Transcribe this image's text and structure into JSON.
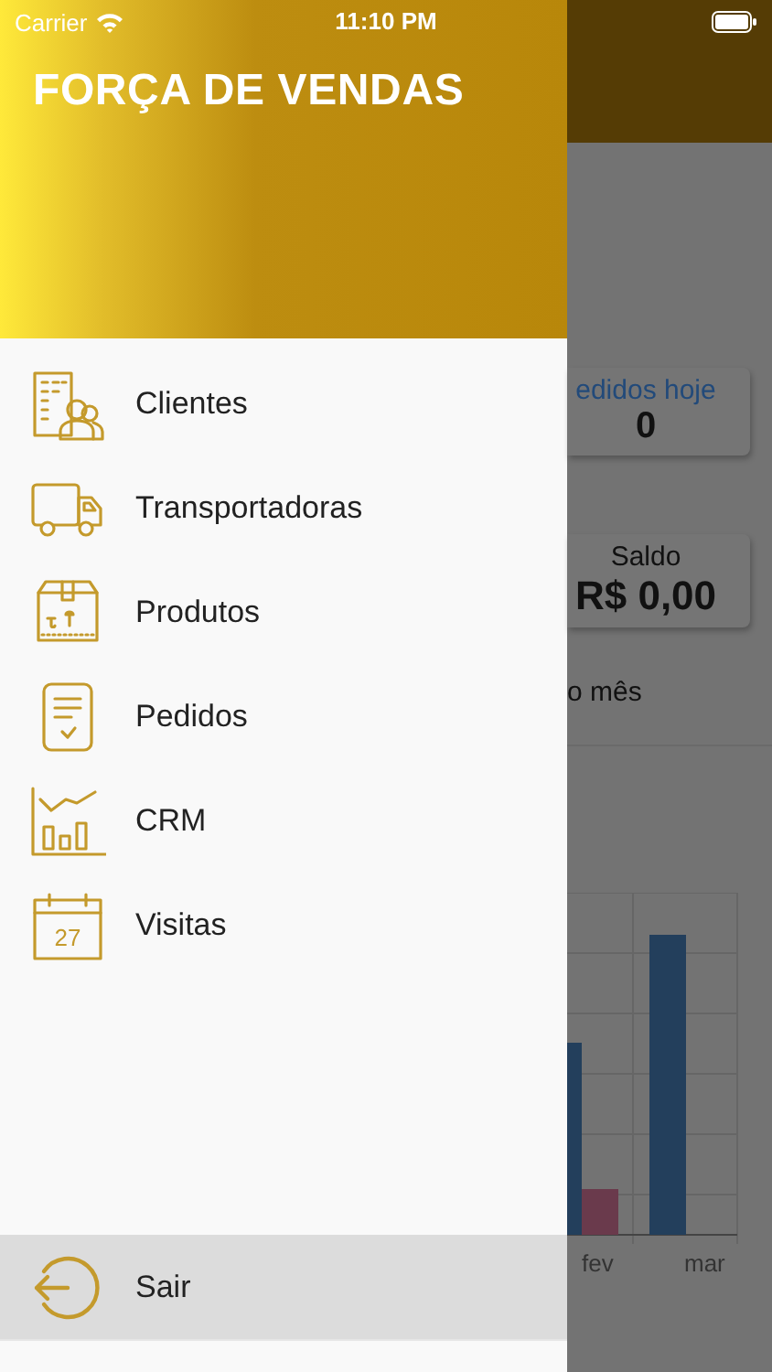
{
  "status_bar": {
    "carrier": "Carrier",
    "time": "11:10 PM"
  },
  "drawer": {
    "title": "FORÇA DE VENDAS",
    "items": [
      {
        "kind": "clients",
        "label": "Clientes"
      },
      {
        "kind": "truck",
        "label": "Transportadoras"
      },
      {
        "kind": "box",
        "label": "Produtos"
      },
      {
        "kind": "orders",
        "label": "Pedidos"
      },
      {
        "kind": "crm",
        "label": "CRM"
      },
      {
        "kind": "calendar",
        "label": "Visitas",
        "day": "27"
      }
    ],
    "logout": {
      "label": "Sair",
      "selected": true
    }
  },
  "background": {
    "cards": [
      {
        "label": "edidos hoje",
        "value": "0",
        "kind": "link"
      },
      {
        "label": "Saldo",
        "value": "R$ 0,00",
        "kind": "plain"
      }
    ],
    "section_title": "o mês",
    "chart_labels": [
      "fev",
      "mar"
    ]
  }
}
